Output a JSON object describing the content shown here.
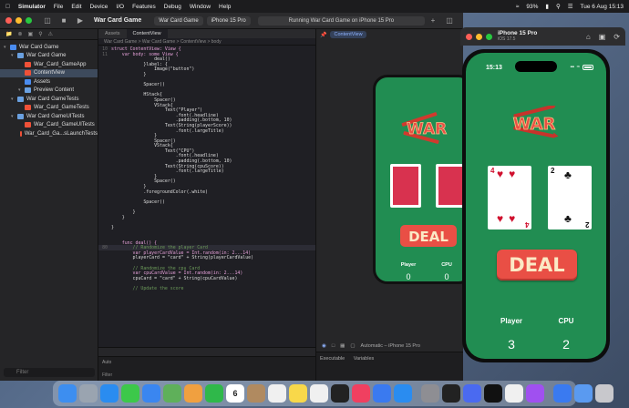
{
  "menubar": {
    "app_name": "Simulator",
    "items": [
      "File",
      "Edit",
      "Device",
      "I/O",
      "Features",
      "Debug",
      "Window",
      "Help"
    ],
    "battery": "93%",
    "datetime": "Tue 6 Aug  15:13"
  },
  "xcode": {
    "project_title": "War Card Game",
    "scheme_tab": "War Card Game",
    "device_tab": "iPhone 15 Pro",
    "status": "Running War Card Game on iPhone 15 Pro",
    "editor_tabs": [
      "Assets",
      "ContentView"
    ],
    "breadcrumb": "War Card Game  >  War Card Game  >  ContentView  >  body",
    "navigator": [
      {
        "label": "War Card Game",
        "level": 0,
        "type": "project"
      },
      {
        "label": "War Card Game",
        "level": 1,
        "type": "folder"
      },
      {
        "label": "War_Card_GameApp",
        "level": 2,
        "type": "swift"
      },
      {
        "label": "ContentView",
        "level": 2,
        "type": "swift",
        "selected": true
      },
      {
        "label": "Assets",
        "level": 2,
        "type": "assets"
      },
      {
        "label": "Preview Content",
        "level": 2,
        "type": "folder"
      },
      {
        "label": "War Card GameTests",
        "level": 1,
        "type": "folder"
      },
      {
        "label": "War_Card_GameTests",
        "level": 2,
        "type": "swift"
      },
      {
        "label": "War Card GameUITests",
        "level": 1,
        "type": "folder"
      },
      {
        "label": "War_Card_GameUITests",
        "level": 2,
        "type": "swift"
      },
      {
        "label": "War_Card_Ga...sLaunchTests",
        "level": 2,
        "type": "swift"
      }
    ],
    "nav_filter_placeholder": "Filter",
    "code_lines": [
      {
        "n": "10",
        "t": "struct ContentView: View {"
      },
      {
        "n": "11",
        "t": "    var body: some View {"
      },
      {
        "n": "",
        "t": "                deal()"
      },
      {
        "n": "",
        "t": "            }label: {"
      },
      {
        "n": "",
        "t": "                Image(\"button\")"
      },
      {
        "n": "",
        "t": "            }"
      },
      {
        "n": "",
        "t": ""
      },
      {
        "n": "",
        "t": "            Spacer()"
      },
      {
        "n": "",
        "t": ""
      },
      {
        "n": "",
        "t": "            HStack{"
      },
      {
        "n": "",
        "t": "                Spacer()"
      },
      {
        "n": "",
        "t": "                VStack{"
      },
      {
        "n": "",
        "t": "                    Text(\"Player\")"
      },
      {
        "n": "",
        "t": "                        .font(.headline)"
      },
      {
        "n": "",
        "t": "                        .padding(.bottom, 10)"
      },
      {
        "n": "",
        "t": "                    Text(String(playerScore))"
      },
      {
        "n": "",
        "t": "                        .font(.largeTitle)"
      },
      {
        "n": "",
        "t": "                }"
      },
      {
        "n": "",
        "t": "                Spacer()"
      },
      {
        "n": "",
        "t": "                VStack{"
      },
      {
        "n": "",
        "t": "                    Text(\"CPU\")"
      },
      {
        "n": "",
        "t": "                        .font(.headline)"
      },
      {
        "n": "",
        "t": "                        .padding(.bottom, 10)"
      },
      {
        "n": "",
        "t": "                    Text(String(cpuScore))"
      },
      {
        "n": "",
        "t": "                        .font(.largeTitle)"
      },
      {
        "n": "",
        "t": "                }"
      },
      {
        "n": "",
        "t": "                Spacer()"
      },
      {
        "n": "",
        "t": "            }"
      },
      {
        "n": "",
        "t": "            .foregroundColor(.white)"
      },
      {
        "n": "",
        "t": ""
      },
      {
        "n": "",
        "t": "            Spacer()"
      },
      {
        "n": "",
        "t": ""
      },
      {
        "n": "",
        "t": "        }"
      },
      {
        "n": "",
        "t": "    }"
      },
      {
        "n": "",
        "t": ""
      },
      {
        "n": "",
        "t": "}"
      },
      {
        "n": "",
        "t": ""
      },
      {
        "n": "",
        "t": ""
      },
      {
        "n": "",
        "t": "    func deal() {"
      },
      {
        "n": "80",
        "t": "        // Randomize the player Card"
      },
      {
        "n": "",
        "t": "        var playerCardValue = Int.random(in: 2...14)"
      },
      {
        "n": "",
        "t": "        playerCard = \"card\" + String(playerCardValue)"
      },
      {
        "n": "",
        "t": ""
      },
      {
        "n": "",
        "t": "        // Randomize the cpu Card"
      },
      {
        "n": "",
        "t": "        var cpuCardValue = Int.random(in: 2...14)"
      },
      {
        "n": "",
        "t": "        cpuCard = \"card\" + String(cpuCardValue)"
      },
      {
        "n": "",
        "t": ""
      },
      {
        "n": "",
        "t": "        // Update the score"
      }
    ],
    "console_filter": "Filter",
    "console_mode": "Auto",
    "canvas_pill": "ContentView",
    "canvas_device": "Automatic – iPhone 15 Pro",
    "canvas_tabs": [
      "Executable",
      "Variables"
    ]
  },
  "preview": {
    "player_label": "Player",
    "cpu_label": "CPU",
    "player_score": "0",
    "cpu_score": "0",
    "deal_label": "DEAL",
    "logo": "WAR"
  },
  "simulator": {
    "device_name": "iPhone 15 Pro",
    "ios_version": "iOS 17.5",
    "time": "15:13",
    "logo": "WAR",
    "player_card": {
      "rank": "4",
      "suit": "♥",
      "color": "#d0102e"
    },
    "cpu_card": {
      "rank": "2",
      "suit": "♣",
      "color": "#111111"
    },
    "deal_label": "DEAL",
    "player_label": "Player",
    "cpu_label": "CPU",
    "player_score": "3",
    "cpu_score": "2"
  },
  "colors": {
    "table_green": "#218d52",
    "deal_red": "#e94f45",
    "card_red": "#d0102e"
  },
  "dock": [
    "Finder",
    "Launchpad",
    "Safari",
    "Messages",
    "Mail",
    "Maps",
    "Photos",
    "FaceTime",
    "Calendar",
    "Contacts",
    "Reminders",
    "Notes",
    "Freeform",
    "TV",
    "Music",
    "Keynote",
    "App Store",
    "System Settings",
    "Terminal",
    "iPhone Mirroring",
    "Notion",
    "Chrome",
    "Messenger",
    "Xcode",
    "Preview",
    "Trash"
  ],
  "calendar_day": "6"
}
